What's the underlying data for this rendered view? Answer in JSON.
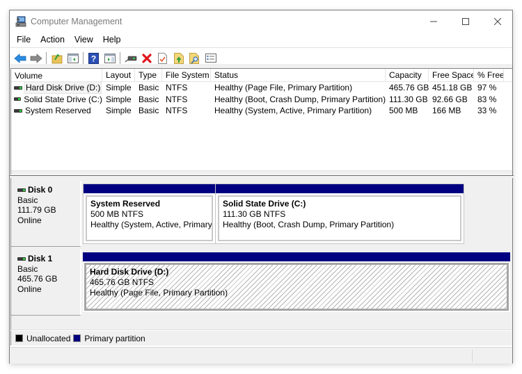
{
  "window": {
    "title": "Computer Management",
    "controls": {
      "minimize": "–",
      "maximize": "☐",
      "close": "✕"
    }
  },
  "menu": [
    "File",
    "Action",
    "View",
    "Help"
  ],
  "toolbar": {
    "buttons": [
      {
        "name": "back",
        "icon": "back-arrow-icon"
      },
      {
        "name": "forward",
        "icon": "forward-arrow-icon"
      },
      {
        "name": "up-one-level",
        "icon": "folder-up-icon"
      },
      {
        "name": "show-hide-console-tree",
        "icon": "console-tree-icon"
      },
      {
        "name": "help",
        "icon": "help-icon"
      },
      {
        "name": "show-hide-action-pane",
        "icon": "action-pane-icon"
      },
      {
        "name": "connect-virtual-disk",
        "icon": "drive-connect-icon"
      },
      {
        "name": "delete",
        "icon": "delete-icon"
      },
      {
        "name": "properties",
        "icon": "properties-check-icon"
      },
      {
        "name": "export-list",
        "icon": "export-icon"
      },
      {
        "name": "find",
        "icon": "search-doc-icon"
      },
      {
        "name": "settings-list",
        "icon": "list-settings-icon"
      }
    ]
  },
  "volume_list": {
    "columns": [
      "Volume",
      "Layout",
      "Type",
      "File System",
      "Status",
      "Capacity",
      "Free Space",
      "% Free"
    ],
    "rows": [
      {
        "volume": "Hard Disk Drive (D:)",
        "layout": "Simple",
        "type": "Basic",
        "fs": "NTFS",
        "status": "Healthy (Page File, Primary Partition)",
        "capacity": "465.76 GB",
        "free": "451.18 GB",
        "pct": "97 %",
        "selected": true
      },
      {
        "volume": "Solid State Drive (C:)",
        "layout": "Simple",
        "type": "Basic",
        "fs": "NTFS",
        "status": "Healthy (Boot, Crash Dump, Primary Partition)",
        "capacity": "111.30 GB",
        "free": "92.66 GB",
        "pct": "83 %",
        "selected": false
      },
      {
        "volume": "System Reserved",
        "layout": "Simple",
        "type": "Basic",
        "fs": "NTFS",
        "status": "Healthy (System, Active, Primary Partition)",
        "capacity": "500 MB",
        "free": "166 MB",
        "pct": "33 %",
        "selected": false
      }
    ]
  },
  "disks": [
    {
      "name": "Disk 0",
      "type": "Basic",
      "size": "111.79 GB",
      "state": "Online",
      "partitions": [
        {
          "name": "System Reserved",
          "size_fs": "500 MB NTFS",
          "status": "Healthy (System, Active, Primary I"
        },
        {
          "name": "Solid State Drive  (C:)",
          "size_fs": "111.30 GB NTFS",
          "status": "Healthy (Boot, Crash Dump, Primary Partition)"
        }
      ]
    },
    {
      "name": "Disk 1",
      "type": "Basic",
      "size": "465.76 GB",
      "state": "Online",
      "partitions": [
        {
          "name": "Hard Disk Drive  (D:)",
          "size_fs": "465.76 GB NTFS",
          "status": "Healthy (Page File, Primary Partition)",
          "selected": true
        }
      ]
    }
  ],
  "legend": [
    {
      "label": "Unallocated",
      "color": "#000000"
    },
    {
      "label": "Primary partition",
      "color": "#000080"
    }
  ]
}
